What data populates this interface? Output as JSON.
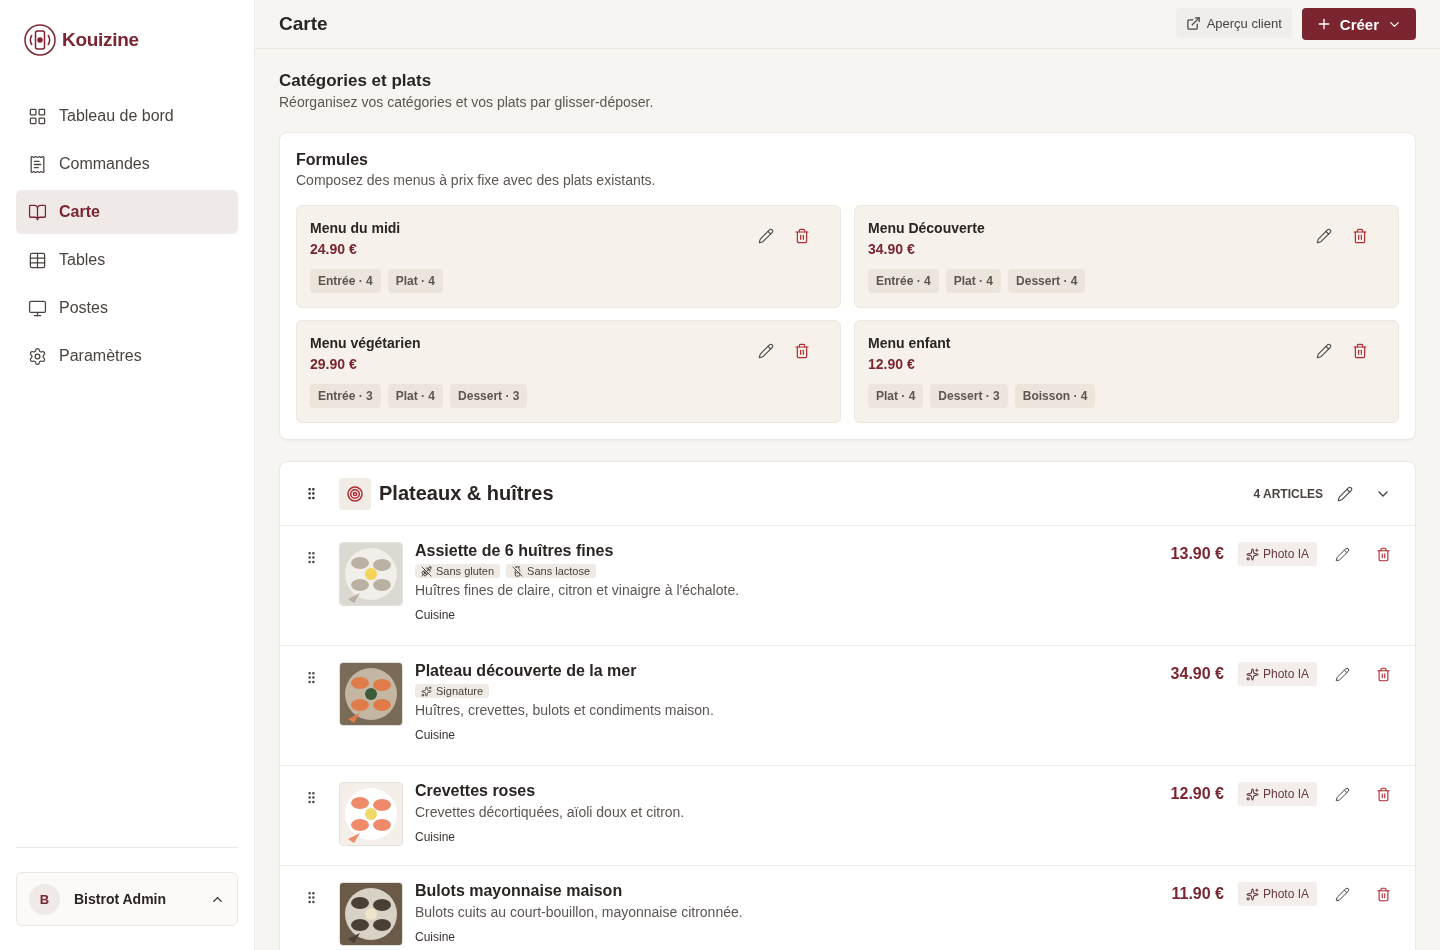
{
  "brand": {
    "name": "Kouizine"
  },
  "nav": [
    {
      "label": "Tableau de bord",
      "selected": false
    },
    {
      "label": "Commandes",
      "selected": false
    },
    {
      "label": "Carte",
      "selected": true
    },
    {
      "label": "Tables",
      "selected": false
    },
    {
      "label": "Postes",
      "selected": false
    },
    {
      "label": "Paramètres",
      "selected": false
    }
  ],
  "user": {
    "initial": "B",
    "name": "Bistrot Admin"
  },
  "header": {
    "title": "Carte",
    "preview_button": "Aperçu client",
    "create_button": "Créer"
  },
  "intro": {
    "title": "Catégories et plats",
    "subtitle": "Réorganisez vos catégories et vos plats par glisser-déposer."
  },
  "formulas": {
    "title": "Formules",
    "subtitle": "Composez des menus à prix fixe avec des plats existants.",
    "items": [
      {
        "name": "Menu du midi",
        "price": "24.90 €",
        "courses": [
          "Entrée · 4",
          "Plat · 4"
        ]
      },
      {
        "name": "Menu Découverte",
        "price": "34.90 €",
        "courses": [
          "Entrée · 4",
          "Plat · 4",
          "Dessert · 4"
        ]
      },
      {
        "name": "Menu végétarien",
        "price": "29.90 €",
        "courses": [
          "Entrée · 3",
          "Plat · 4",
          "Dessert · 3"
        ]
      },
      {
        "name": "Menu enfant",
        "price": "12.90 €",
        "courses": [
          "Plat · 4",
          "Dessert · 3",
          "Boisson · 4"
        ]
      }
    ]
  },
  "category": {
    "name": "Plateaux & huîtres",
    "count": "4 ARTICLES",
    "expanded": true,
    "dishes": [
      {
        "name": "Assiette de 6 huîtres fines",
        "tags": [
          {
            "kind": "gluten-free",
            "label": "Sans gluten"
          },
          {
            "kind": "lactose-free",
            "label": "Sans lactose"
          }
        ],
        "description": "Huîtres fines de claire, citron et vinaigre à l'échalote.",
        "station": "Cuisine",
        "price": "13.90 €",
        "ai_button": "Photo IA"
      },
      {
        "name": "Plateau découverte de la mer",
        "tags": [
          {
            "kind": "signature",
            "label": "Signature"
          }
        ],
        "description": "Huîtres, crevettes, bulots et condiments maison.",
        "station": "Cuisine",
        "price": "34.90 €",
        "ai_button": "Photo IA"
      },
      {
        "name": "Crevettes roses",
        "description": "Crevettes décortiquées, aïoli doux et citron.",
        "station": "Cuisine",
        "price": "12.90 €",
        "ai_button": "Photo IA"
      },
      {
        "name": "Bulots mayonnaise maison",
        "description": "Bulots cuits au court-bouillon, mayonnaise citronnée.",
        "station": "Cuisine",
        "price": "11.90 €",
        "ai_button": "Photo IA"
      }
    ]
  }
}
